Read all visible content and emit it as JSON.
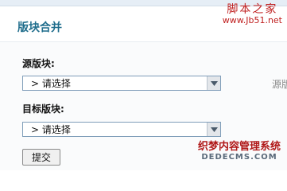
{
  "watermark_top": {
    "chinese": "脚本之家",
    "url": "www.Jb51.net"
  },
  "page": {
    "title": "版块合并"
  },
  "form": {
    "source": {
      "label": "源版块:",
      "selected": "> 请选择",
      "trailing_text": "源版"
    },
    "target": {
      "label": "目标版块:",
      "selected": "> 请选择"
    },
    "submit_label": "提交"
  },
  "watermark_bottom": {
    "chinese": "织梦内容管理系统",
    "url": "DEDECMS.COM"
  }
}
